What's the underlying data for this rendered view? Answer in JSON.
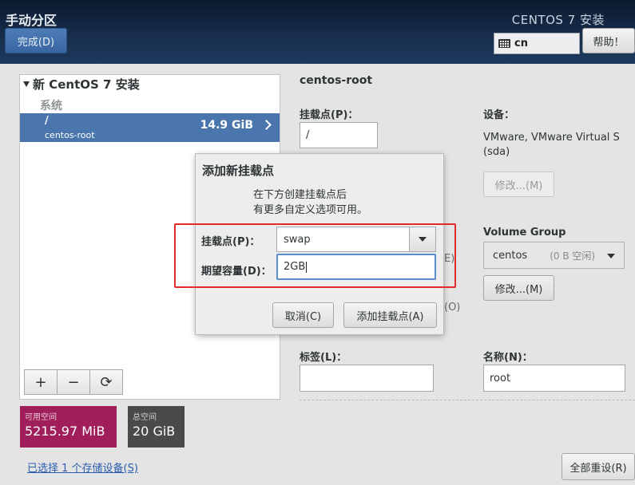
{
  "header": {
    "title": "手动分区",
    "done_label": "完成(D)",
    "product": "CENTOS 7 安装",
    "keyboard_layout": "cn",
    "help_label": "帮助！"
  },
  "tree": {
    "title": "新 CentOS 7 安装",
    "section": "系统",
    "mounts": [
      {
        "path": "/",
        "device": "centos-root",
        "size": "14.9 GiB"
      }
    ]
  },
  "toolbar": {
    "add_label": "+",
    "remove_label": "−",
    "refresh_label": "⟳"
  },
  "space": {
    "available_label": "可用空间",
    "available_value": "5215.97 MiB",
    "total_label": "总空间",
    "total_value": "20 GiB"
  },
  "storage_link": "已选择 1 个存储设备(S)",
  "detail": {
    "title": "centos-root",
    "mount_label": "挂载点(P)：",
    "mount_value": "/",
    "device_label": "设备：",
    "device_value": "VMware, VMware Virtual S",
    "device_sub": "(sda)",
    "modify_label": "修改...(M)",
    "volume_group_label": "Volume Group",
    "vg_value": "centos",
    "vg_sub": "(0 B 空闲)",
    "vg_modify_label": "修改...(M)",
    "clipped_1": "E)",
    "clipped_2": "(O)",
    "tag_label": "标签(L)：",
    "tag_value": "",
    "name_label": "名称(N)：",
    "name_value": "root"
  },
  "reset_label": "全部重设(R)",
  "dialog": {
    "title": "添加新挂载点",
    "desc_line1": "在下方创建挂载点后",
    "desc_line2": "有更多自定义选项可用。",
    "mount_label": "挂载点(P)：",
    "mount_value": "swap",
    "capacity_label": "期望容量(D)：",
    "capacity_value": "2GB",
    "cancel_label": "取消(C)",
    "add_label": "添加挂载点(A)"
  },
  "colors": {
    "accent": "#4a76ad",
    "available_space": "#a01f5a",
    "total_space": "#4a4a4a",
    "highlight": "#e02b2b"
  }
}
